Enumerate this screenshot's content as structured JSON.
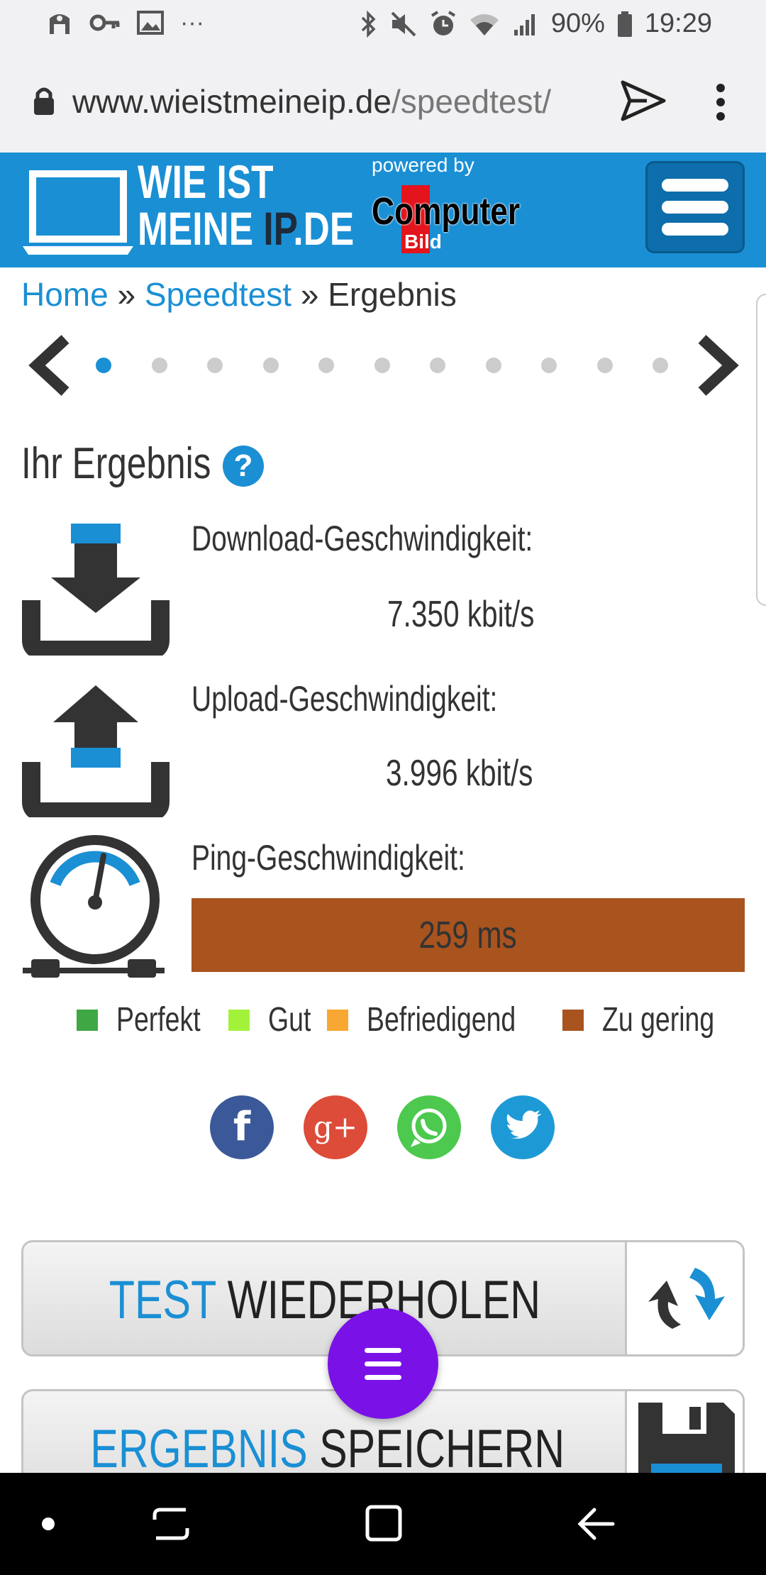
{
  "status_bar": {
    "battery": "90%",
    "time": "19:29",
    "icons": [
      "accessibility-icon",
      "key-icon",
      "image-icon",
      "more-notifications-icon",
      "bluetooth-icon",
      "mute-icon",
      "alarm-icon",
      "wifi-icon",
      "signal-icon",
      "battery-icon"
    ],
    "more": "···"
  },
  "browser": {
    "url_host": "www.wieistmeineip.de",
    "url_path": "/speedtest/"
  },
  "site_header": {
    "logo_line1": "WIE IST",
    "logo_line2_a": "MEINE ",
    "logo_line2_b": "IP",
    "logo_line2_c": ".DE",
    "powered_by": "powered by",
    "partner_a": "Computer",
    "partner_b": "Bild"
  },
  "breadcrumb": {
    "home": "Home",
    "sep1": " » ",
    "speedtest": "Speedtest",
    "sep2": " » ",
    "current": "Ergebnis"
  },
  "carousel": {
    "active_index": 0,
    "total": 11
  },
  "result": {
    "title": "Ihr Ergebnis",
    "help": "?",
    "download_label": "Download-Geschwindigkeit:",
    "download_value": "7.350 kbit/s",
    "upload_label": "Upload-Geschwindigkeit:",
    "upload_value": "3.996 kbit/s",
    "ping_label": "Ping-Geschwindigkeit:",
    "ping_value": "259 ms",
    "ping_color": "#a9531f"
  },
  "legend": [
    {
      "label": "Perfekt",
      "color": "#3fa845"
    },
    {
      "label": "Gut",
      "color": "#a3f23a"
    },
    {
      "label": "Befriedigend",
      "color": "#f8a832"
    },
    {
      "label": "Zu gering",
      "color": "#a9531f"
    }
  ],
  "social": {
    "facebook": "f",
    "google_plus": "g+",
    "whatsapp_color": "#4cc94e",
    "twitter_color": "#1d9ad6"
  },
  "actions": {
    "repeat_accent": "TEST",
    "repeat_rest": " WIEDERHOLEN",
    "save_accent": "ERGEBNIS",
    "save_rest": " SPEICHERN"
  },
  "colors": {
    "brand": "#1a8fd4",
    "fab": "#7a12e8"
  }
}
